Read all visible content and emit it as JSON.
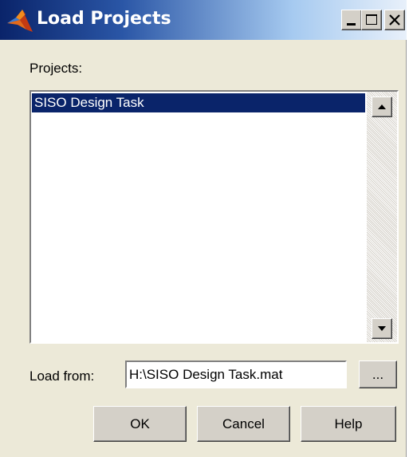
{
  "window": {
    "title": "Load Projects",
    "controls": [
      "minimize-icon",
      "maximize-icon",
      "close-icon"
    ]
  },
  "projects": {
    "label": "Projects:",
    "items": [
      "SISO Design Task"
    ],
    "selected_index": 0
  },
  "load_from": {
    "label": "Load from:",
    "value": "H:\\SISO Design Task.mat",
    "browse_label": "..."
  },
  "buttons": {
    "ok": "OK",
    "cancel": "Cancel",
    "help": "Help"
  },
  "colors": {
    "selection": "#0a246a",
    "titlebar_start": "#0a246a",
    "titlebar_end": "#a6caf0",
    "dialog_background": "#ece9d8"
  }
}
